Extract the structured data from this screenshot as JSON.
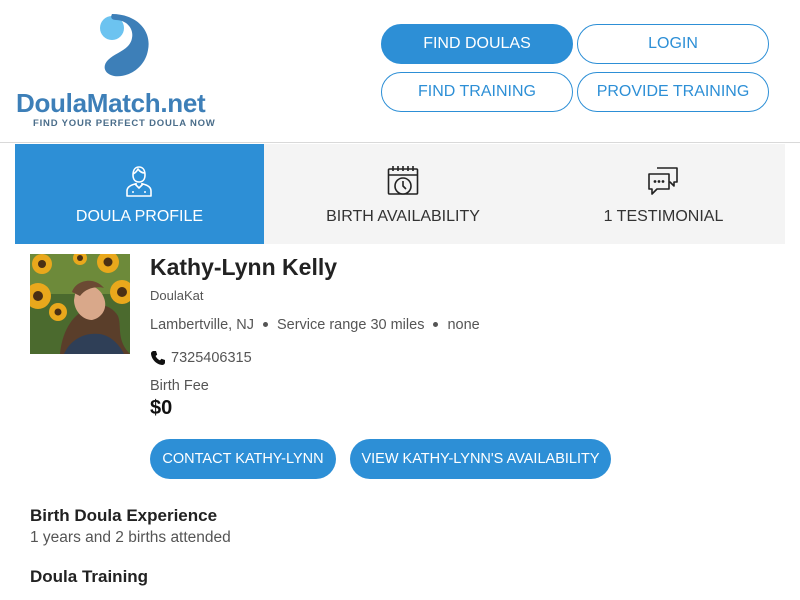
{
  "brand": {
    "name": "DoulaMatch.net",
    "tagline": "FIND YOUR PERFECT DOULA NOW",
    "colors": {
      "primary": "#2d8fd6",
      "logo_dark": "#3d7fb8",
      "logo_light": "#6cc3f0"
    }
  },
  "nav": {
    "find_doulas": "FIND DOULAS",
    "login": "LOGIN",
    "find_training": "FIND TRAINING",
    "provide_training": "PROVIDE TRAINING"
  },
  "tabs": [
    {
      "label": "DOULA PROFILE",
      "icon": "person-icon",
      "active": true
    },
    {
      "label": "BIRTH AVAILABILITY",
      "icon": "calendar-clock-icon",
      "active": false
    },
    {
      "label": "1 TESTIMONIAL",
      "icon": "chat-bubbles-icon",
      "active": false
    }
  ],
  "profile": {
    "name": "Kathy-Lynn Kelly",
    "username": "DoulaKat",
    "location": "Lambertville, NJ",
    "service_range": "Service range 30 miles",
    "extra": "none",
    "phone": "7325406315",
    "fee_label": "Birth Fee",
    "fee_value": "$0",
    "contact_button": "CONTACT KATHY-LYNN",
    "availability_button": "VIEW KATHY-LYNN'S AVAILABILITY"
  },
  "sections": {
    "experience_title": "Birth Doula Experience",
    "experience_text": "1 years and 2 births attended",
    "training_title": "Doula Training"
  }
}
